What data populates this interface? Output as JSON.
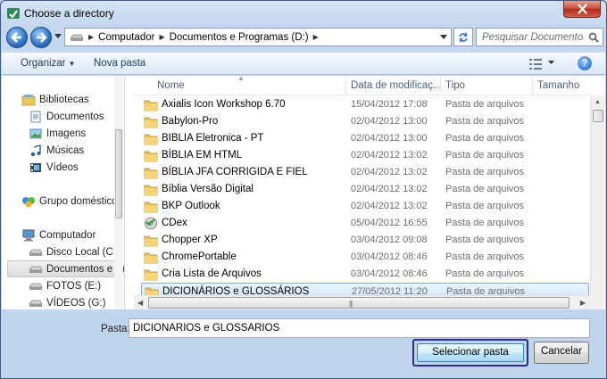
{
  "window": {
    "title": "Choose a directory",
    "close_icon": "close-x-icon"
  },
  "nav": {
    "back_icon": "back-arrow-icon",
    "forward_icon": "forward-arrow-icon",
    "address": {
      "crumbs": [
        "Computador",
        "Documentos e Programas (D:)"
      ]
    },
    "search_placeholder": "Pesquisar Documentos e..."
  },
  "toolbar": {
    "organize_label": "Organizar",
    "new_folder_label": "Nova pasta",
    "help_label": "?"
  },
  "sidebar": {
    "items": [
      {
        "label": "Bibliotecas",
        "icon": "libraries-icon"
      },
      {
        "label": "Documentos",
        "icon": "documents-icon"
      },
      {
        "label": "Imagens",
        "icon": "pictures-icon"
      },
      {
        "label": "Músicas",
        "icon": "music-icon"
      },
      {
        "label": "Vídeos",
        "icon": "videos-icon"
      },
      {
        "label": "Grupo doméstico",
        "icon": "homegroup-icon"
      },
      {
        "label": "Computador",
        "icon": "computer-icon"
      },
      {
        "label": "Disco Local (C:)",
        "icon": "drive-icon"
      },
      {
        "label": "Documentos e Pr",
        "icon": "drive-icon"
      },
      {
        "label": "FOTOS (E:)",
        "icon": "drive-icon"
      },
      {
        "label": "VÍDEOS (G:)",
        "icon": "drive-icon"
      }
    ],
    "selected_index": 8
  },
  "list": {
    "columns": [
      "Nome",
      "Data de modificaç...",
      "Tipo",
      "Tamanho"
    ],
    "rows": [
      {
        "name": "Axialis Icon Workshop 6.70",
        "date": "15/04/2012 17:08",
        "type": "Pasta de arquivos",
        "icon": "folder"
      },
      {
        "name": "Babylon-Pro",
        "date": "02/04/2012 13:00",
        "type": "Pasta de arquivos",
        "icon": "folder"
      },
      {
        "name": "BIBLIA Eletronica - PT",
        "date": "02/04/2012 13:00",
        "type": "Pasta de arquivos",
        "icon": "folder"
      },
      {
        "name": "BÍBLIA EM HTML",
        "date": "02/04/2012 13:02",
        "type": "Pasta de arquivos",
        "icon": "folder"
      },
      {
        "name": "BÍBLIA JFA CORRIGIDA E FIEL",
        "date": "02/04/2012 13:02",
        "type": "Pasta de arquivos",
        "icon": "folder"
      },
      {
        "name": "Bíblia Versão Digital",
        "date": "02/04/2012 13:02",
        "type": "Pasta de arquivos",
        "icon": "folder"
      },
      {
        "name": "BKP Outlook",
        "date": "02/04/2012 13:02",
        "type": "Pasta de arquivos",
        "icon": "folder"
      },
      {
        "name": "CDex",
        "date": "05/04/2012 16:55",
        "type": "Pasta de arquivos",
        "icon": "cdex"
      },
      {
        "name": "Chopper XP",
        "date": "03/04/2012 09:08",
        "type": "Pasta de arquivos",
        "icon": "folder"
      },
      {
        "name": "ChromePortable",
        "date": "03/04/2012 08:46",
        "type": "Pasta de arquivos",
        "icon": "folder"
      },
      {
        "name": "Cria Lista de Arquivos",
        "date": "03/04/2012 08:46",
        "type": "Pasta de arquivos",
        "icon": "folder"
      },
      {
        "name": "DICIONÁRIOS e GLOSSÁRIOS",
        "date": "27/05/2012 11:20",
        "type": "Pasta de arquivos",
        "icon": "folder"
      }
    ],
    "selected_index": 11
  },
  "footer": {
    "folder_label": "Pasta:",
    "folder_value": "DICIONÁRIOS e GLOSSÁRIOS",
    "select_button": "Selecionar pasta",
    "cancel_button": "Cancelar"
  }
}
